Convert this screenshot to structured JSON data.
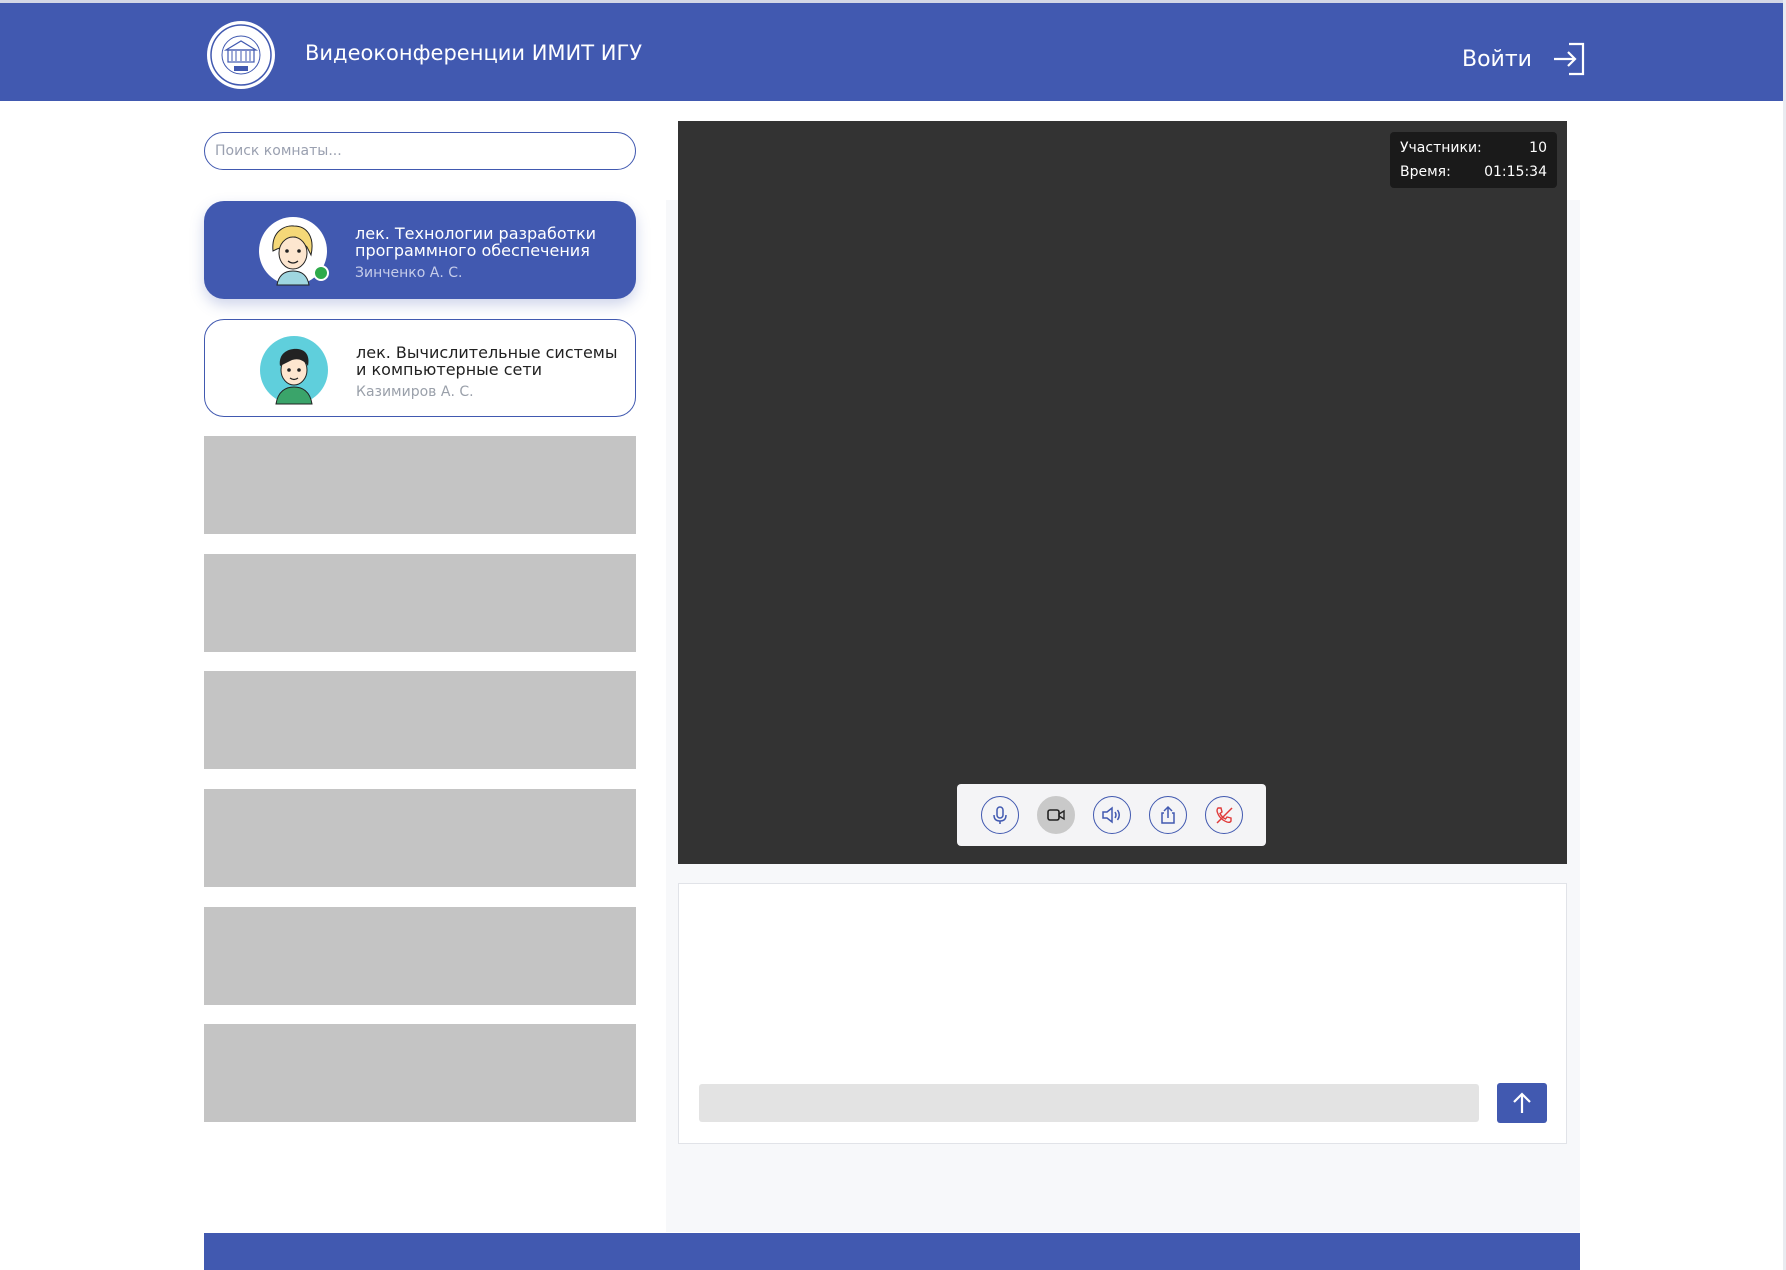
{
  "header": {
    "title": "Видеоконференции ИМИТ ИГУ",
    "login_label": "Войти"
  },
  "search": {
    "placeholder": "Поиск комнаты..."
  },
  "rooms": [
    {
      "title_line1": "лек. Технологии разработки",
      "title_line2": "программного обеспечения",
      "author": "Зинченко А. С.",
      "active": true,
      "online": true
    },
    {
      "title_line1": "лек. Вычислительные системы",
      "title_line2": "и компьютерные сети",
      "author": "Казимиров А. С.",
      "active": false,
      "online": false
    }
  ],
  "placeholder_count": 6,
  "video": {
    "participants_label": "Участники:",
    "participants_value": "10",
    "time_label": "Время:",
    "time_value": "01:15:34"
  },
  "controls": [
    "microphone-icon",
    "camera-icon",
    "speaker-icon",
    "share-icon",
    "hangup-icon"
  ],
  "colors": {
    "brand": "#4159b0",
    "video_bg": "#333333",
    "placeholder": "#c4c4c4",
    "online": "#2eaa4a",
    "hangup": "#e03a3a"
  }
}
